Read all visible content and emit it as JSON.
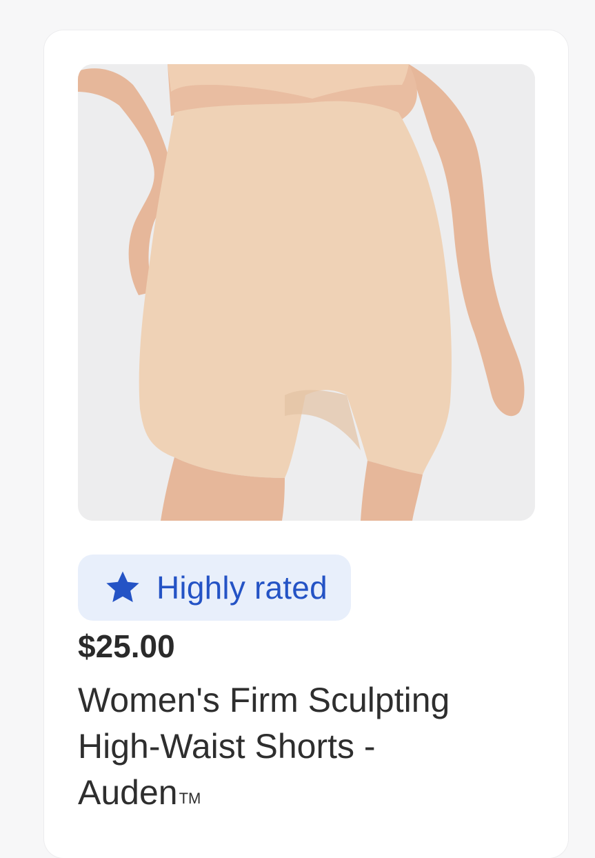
{
  "product": {
    "image_alt": "Women's Firm Sculpting High-Waist Shorts product photo",
    "badge": {
      "icon": "star-icon",
      "label": "Highly rated",
      "color": "#2453c5",
      "background": "#e8effb"
    },
    "price": "$25.00",
    "title_line1": "Women's Firm Sculpting",
    "title_line2": "High-Waist Shorts -",
    "title_line3": "Auden",
    "trademark": "TM"
  }
}
